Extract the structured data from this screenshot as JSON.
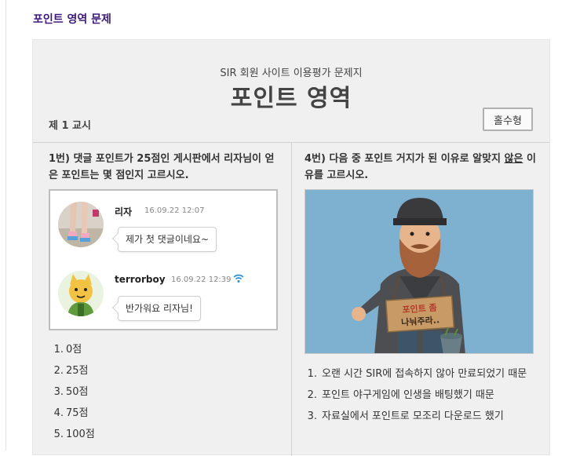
{
  "page": {
    "heading": "포인트 영역 문제"
  },
  "exam": {
    "subtitle": "SIR 회원 사이트 이용평가 문제지",
    "title": "포인트 영역",
    "period": "제 1 교시",
    "type_button": "홀수형"
  },
  "question1": {
    "text": "1번) 댓글 포인트가 25점인 게시판에서 리자님이 얻은 포인트는 몇 점인지 고르시오.",
    "comments": [
      {
        "name": "리자",
        "date": "16.09.22 12:07",
        "text": "제가 첫 댓글이네요~"
      },
      {
        "name": "terrorboy",
        "date": "16.09.22 12:39",
        "text": "반가워요 리자님!"
      }
    ],
    "options": [
      {
        "num": "1.",
        "text": "0점"
      },
      {
        "num": "2.",
        "text": "25점"
      },
      {
        "num": "3.",
        "text": "50점"
      },
      {
        "num": "4.",
        "text": "75점"
      },
      {
        "num": "5.",
        "text": "100점"
      }
    ]
  },
  "question4": {
    "text_before": "4번) 다음 중 포인트 거지가 된 이유로 알맞지 ",
    "text_emph": "않은",
    "text_after": " 이유를 고르시오.",
    "sign_line1": "포인트 좀",
    "sign_line2": "나눠주라..",
    "options": [
      {
        "num": "1.",
        "text": "오랜 시간 SIR에 접속하지 않아 만료되었기 때문"
      },
      {
        "num": "2.",
        "text": "포인트 야구게임에 인생을 배팅했기 때문"
      },
      {
        "num": "3.",
        "text": "자료실에서 포인트로 모조리 다운로드 했기"
      }
    ]
  },
  "colors": {
    "heading": "#3c1a7a",
    "panel": "#f0f0f0",
    "photo_bg": "#7eb0cf"
  },
  "icons": {
    "signal": "signal-icon"
  }
}
